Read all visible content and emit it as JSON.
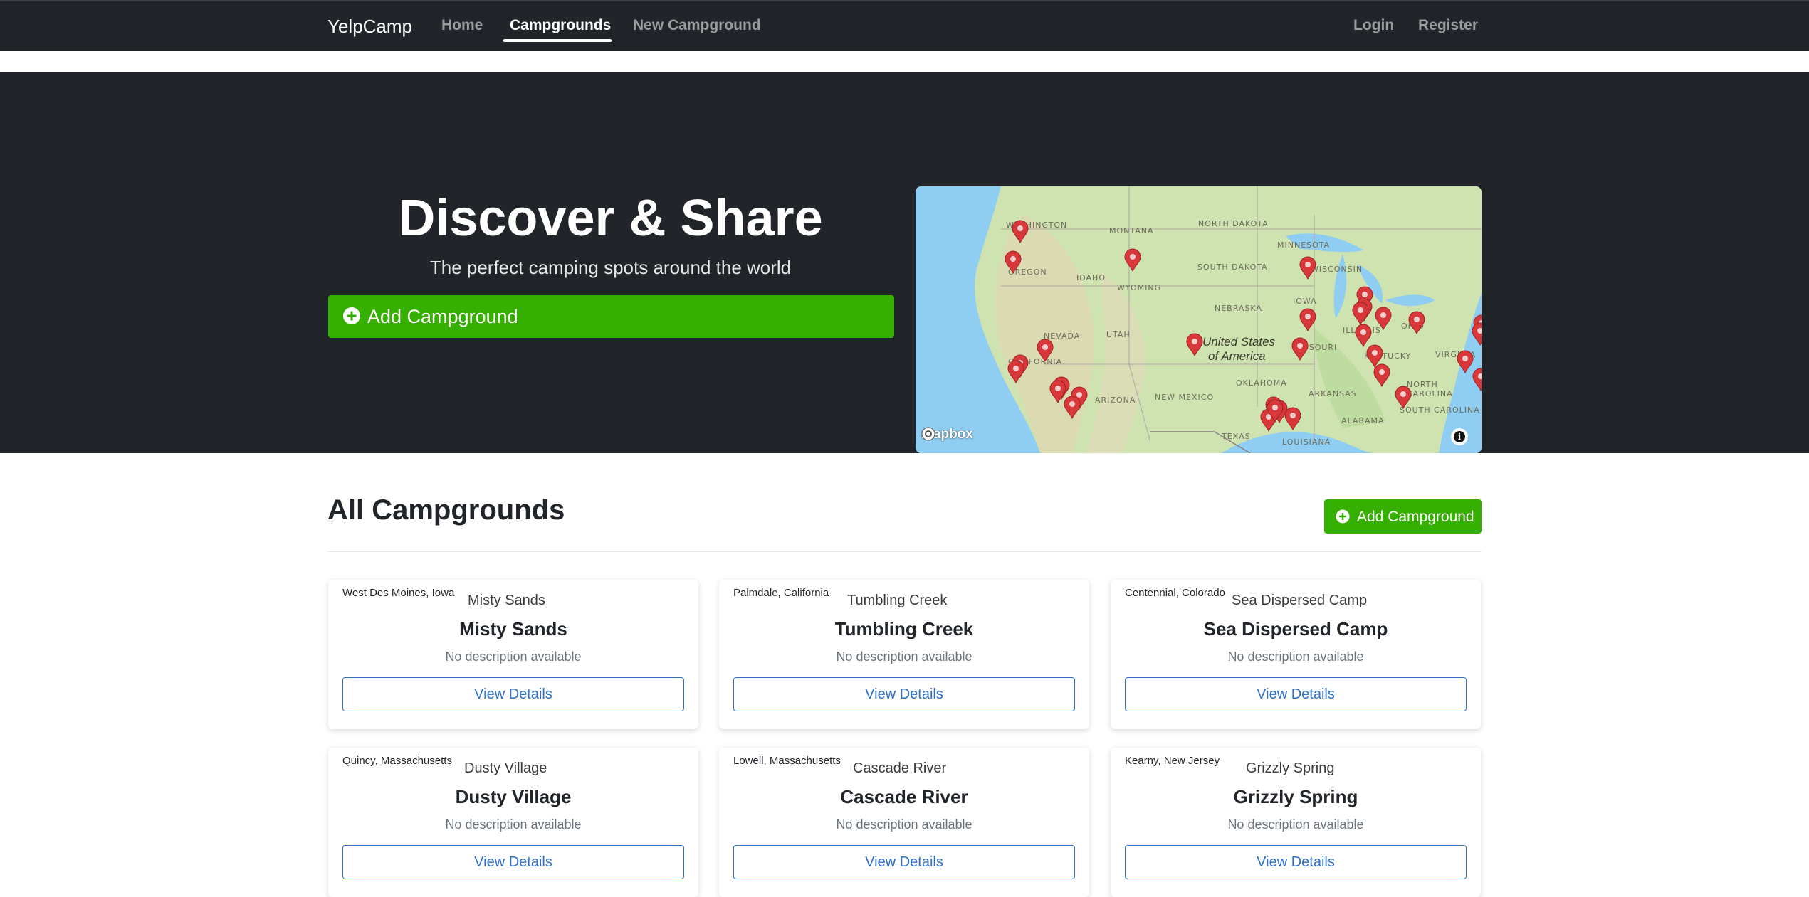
{
  "navbar": {
    "brand": "YelpCamp",
    "links": [
      {
        "label": "Home"
      },
      {
        "label": "Campgrounds"
      },
      {
        "label": "New Campground"
      }
    ],
    "right_links": [
      {
        "label": "Login"
      },
      {
        "label": "Register"
      }
    ]
  },
  "hero": {
    "title": "Discover & Share",
    "subtitle": "The perfect camping spots around the world",
    "add_button": "Add Campground"
  },
  "map": {
    "states": [
      "WASHINGTON",
      "MONTANA",
      "NORTH DAKOTA",
      "MINNESOTA",
      "OREGON",
      "IDAHO",
      "SOUTH DAKOTA",
      "WISCONSIN",
      "WYOMING",
      "IOWA",
      "NEBRASKA",
      "NEVADA",
      "UTAH",
      "ILLINOIS",
      "OHIO",
      "MISSOURI",
      "KENTUCKY",
      "VIRGINIA",
      "CALIFORNIA",
      "OKLAHOMA",
      "NORTH CAROLINA",
      "ARIZONA",
      "NEW MEXICO",
      "ARKANSAS",
      "SOUTH CAROLINA",
      "ALABAMA",
      "TEXAS",
      "LOUISIANA"
    ],
    "country": "United States of America",
    "country_line1": "United States",
    "country_line2": "of America",
    "attribution": "mapbox",
    "info_icon": "info-icon",
    "marker_color": "#d9383a"
  },
  "section": {
    "title": "All Campgrounds",
    "add_button": "Add Campground"
  },
  "campgrounds": [
    {
      "location": "West Des Moines, Iowa",
      "image_alt": "Misty Sands",
      "title": "Misty Sands",
      "description": "No description available",
      "button": "View Details"
    },
    {
      "location": "Palmdale, California",
      "image_alt": "Tumbling Creek",
      "title": "Tumbling Creek",
      "description": "No description available",
      "button": "View Details"
    },
    {
      "location": "Centennial, Colorado",
      "image_alt": "Sea Dispersed Camp",
      "title": "Sea Dispersed Camp",
      "description": "No description available",
      "button": "View Details"
    },
    {
      "location": "Quincy, Massachusetts",
      "image_alt": "Dusty Village",
      "title": "Dusty Village",
      "description": "No description available",
      "button": "View Details"
    },
    {
      "location": "Lowell, Massachusetts",
      "image_alt": "Cascade River",
      "title": "Cascade River",
      "description": "No description available",
      "button": "View Details"
    },
    {
      "location": "Kearny, New Jersey",
      "image_alt": "Grizzly Spring",
      "title": "Grizzly Spring",
      "description": "No description available",
      "button": "View Details"
    }
  ],
  "colors": {
    "navbar_bg": "#212529",
    "accent_green": "#36b000",
    "link_blue": "#2f6fc7"
  }
}
